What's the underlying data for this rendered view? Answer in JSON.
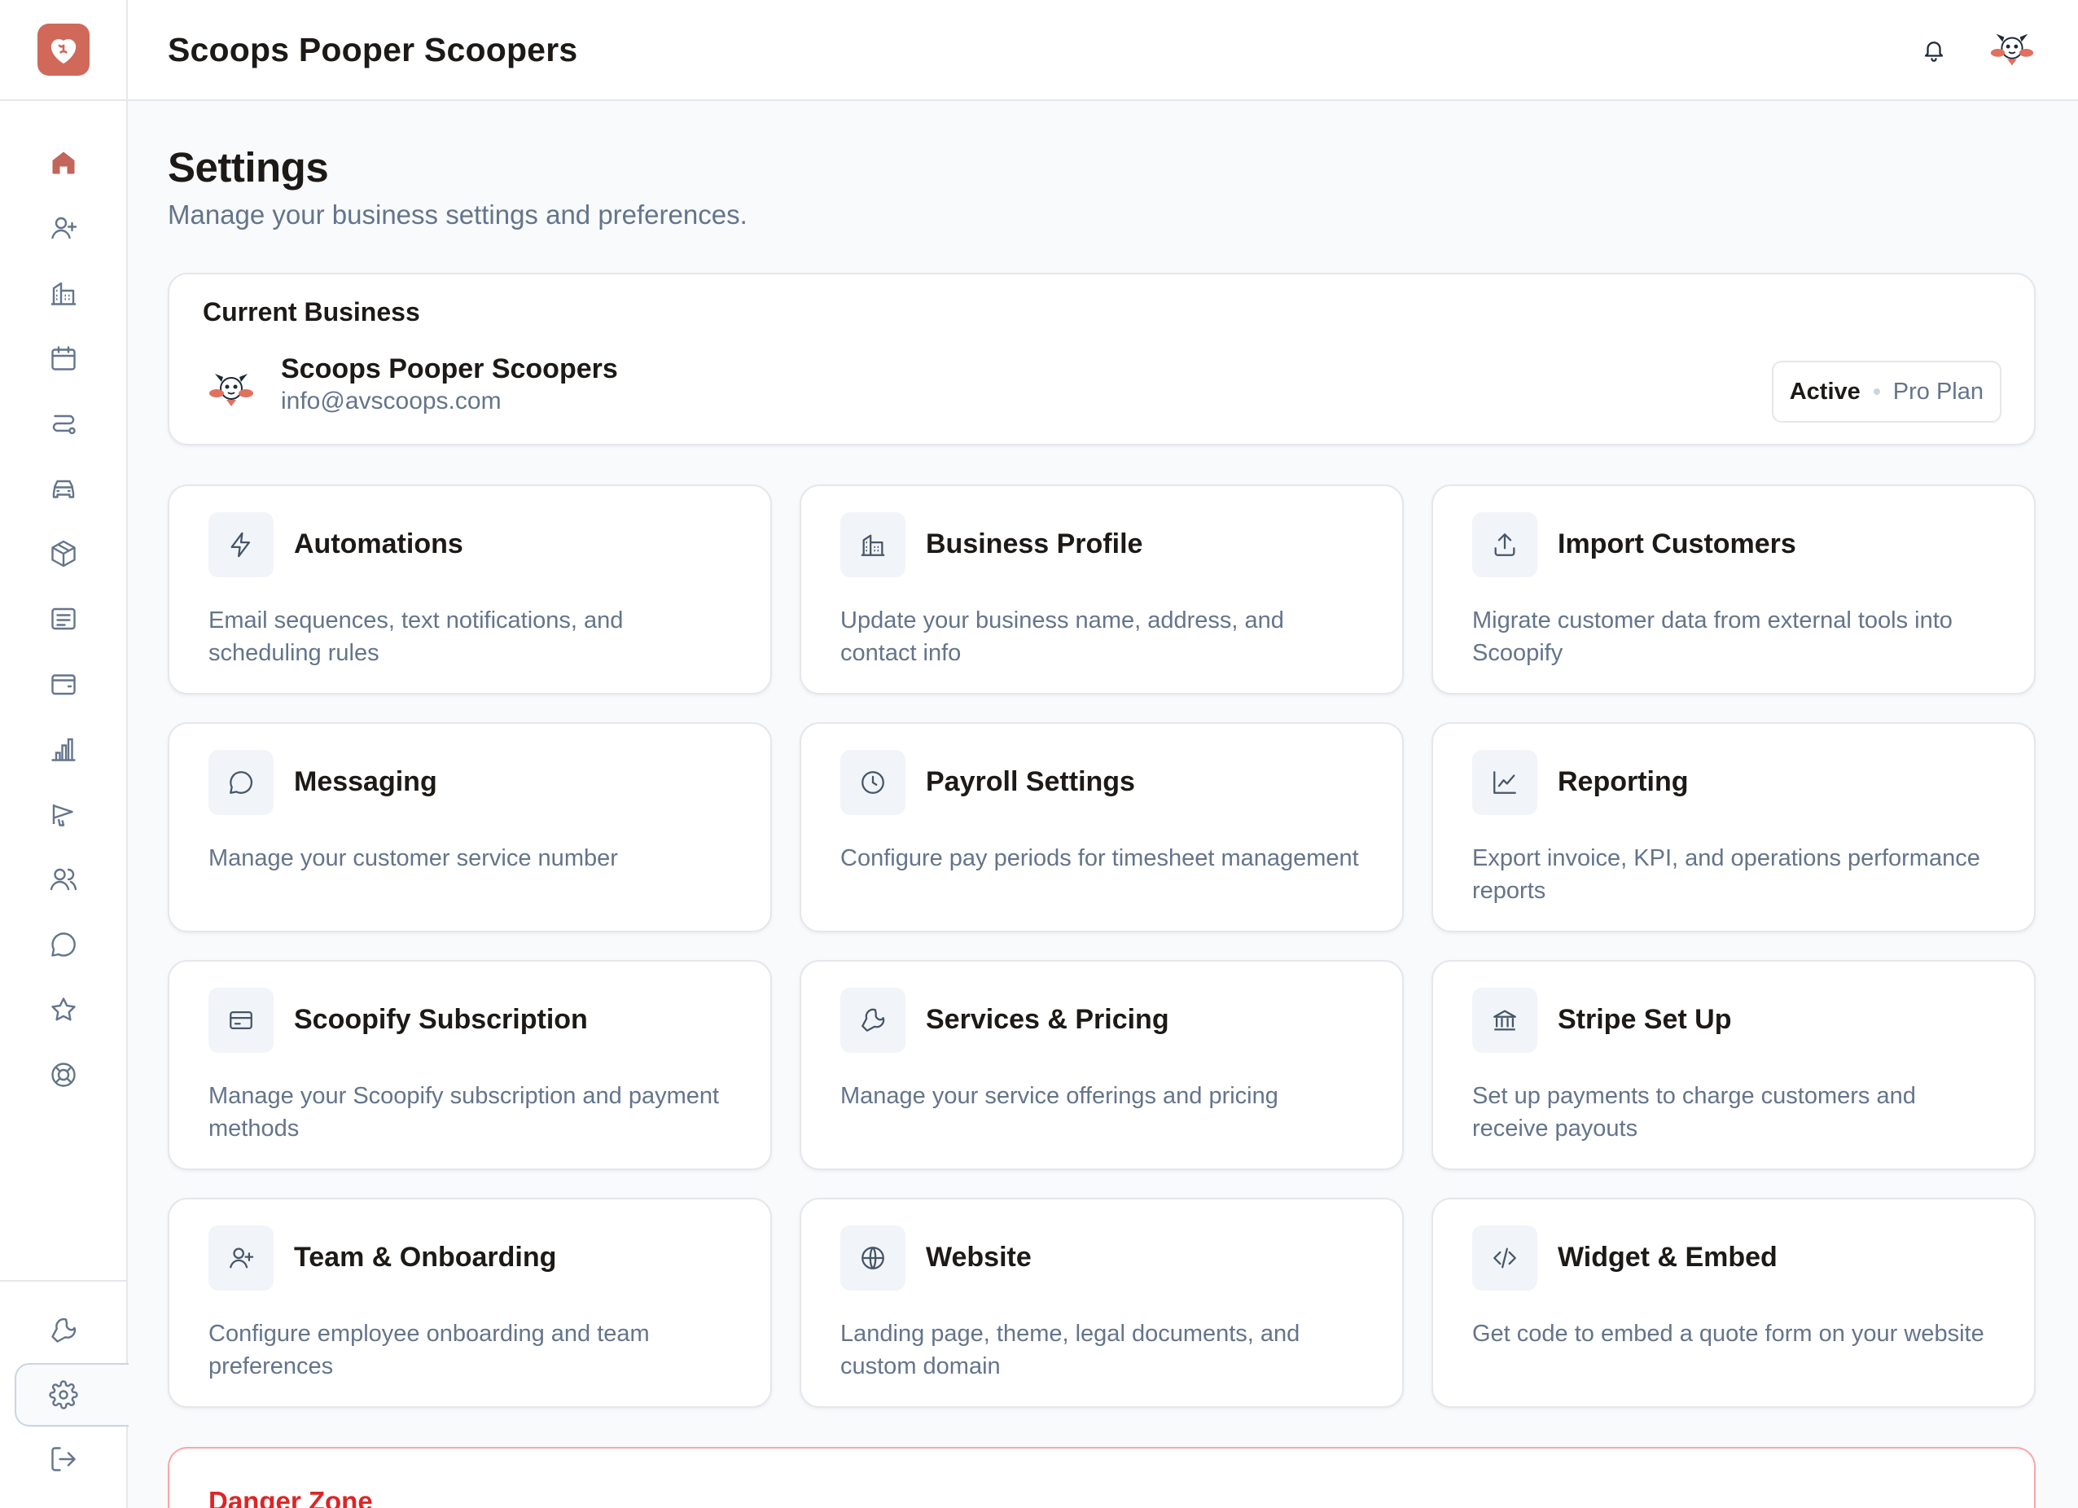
{
  "header": {
    "business_name": "Scoops Pooper Scoopers"
  },
  "sidebar": {
    "items": [
      {
        "icon": "home-icon",
        "active": true
      },
      {
        "icon": "user-plus-icon"
      },
      {
        "icon": "building-icon"
      },
      {
        "icon": "calendar-icon"
      },
      {
        "icon": "route-icon"
      },
      {
        "icon": "car-icon"
      },
      {
        "icon": "package-icon"
      },
      {
        "icon": "document-icon"
      },
      {
        "icon": "wallet-icon"
      },
      {
        "icon": "bar-chart-icon"
      },
      {
        "icon": "megaphone-icon"
      },
      {
        "icon": "users-icon"
      },
      {
        "icon": "message-icon"
      },
      {
        "icon": "star-icon"
      },
      {
        "icon": "lifebuoy-icon"
      }
    ],
    "bottom_items": [
      {
        "icon": "wrench-icon"
      },
      {
        "icon": "gear-icon",
        "selected": true
      },
      {
        "icon": "logout-icon"
      }
    ]
  },
  "page": {
    "title": "Settings",
    "subtitle": "Manage your business settings and preferences."
  },
  "current_business": {
    "label": "Current Business",
    "name": "Scoops Pooper Scoopers",
    "email": "info@avscoops.com",
    "status": "Active",
    "plan": "Pro Plan"
  },
  "cards": [
    {
      "title": "Automations",
      "desc": "Email sequences, text notifications, and scheduling rules",
      "icon": "lightning-icon"
    },
    {
      "title": "Business Profile",
      "desc": "Update your business name, address, and contact info",
      "icon": "building-icon"
    },
    {
      "title": "Import Customers",
      "desc": "Migrate customer data from external tools into Scoopify",
      "icon": "upload-icon"
    },
    {
      "title": "Messaging",
      "desc": "Manage your customer service number",
      "icon": "message-icon"
    },
    {
      "title": "Payroll Settings",
      "desc": "Configure pay periods for timesheet management",
      "icon": "clock-icon"
    },
    {
      "title": "Reporting",
      "desc": "Export invoice, KPI, and operations performance reports",
      "icon": "trend-chart-icon"
    },
    {
      "title": "Scoopify Subscription",
      "desc": "Manage your Scoopify subscription and payment methods",
      "icon": "credit-card-icon"
    },
    {
      "title": "Services & Pricing",
      "desc": "Manage your service offerings and pricing",
      "icon": "wrench-icon"
    },
    {
      "title": "Stripe Set Up",
      "desc": "Set up payments to charge customers and receive payouts",
      "icon": "bank-icon"
    },
    {
      "title": "Team & Onboarding",
      "desc": "Configure employee onboarding and team preferences",
      "icon": "user-plus-icon"
    },
    {
      "title": "Website",
      "desc": "Landing page, theme, legal documents, and custom domain",
      "icon": "globe-icon"
    },
    {
      "title": "Widget & Embed",
      "desc": "Get code to embed a quote form on your website",
      "icon": "code-icon"
    }
  ],
  "danger_zone": {
    "title": "Danger Zone"
  },
  "colors": {
    "brand": "#d0695a",
    "danger": "#dc2626"
  }
}
